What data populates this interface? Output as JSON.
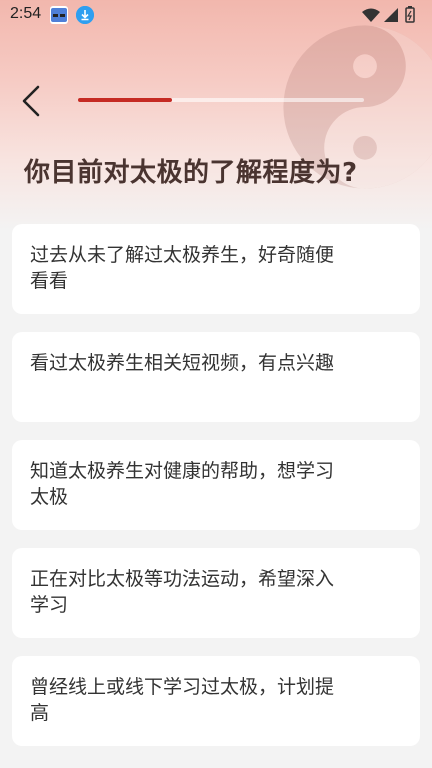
{
  "status_bar": {
    "time": "2:54"
  },
  "progress": {
    "fraction": 0.33
  },
  "question": "你目前对太极的了解程度为?",
  "options": [
    {
      "label": "过去从未了解过太极养生，好奇随便看看"
    },
    {
      "label": "看过太极养生相关短视频，有点兴趣"
    },
    {
      "label": "知道太极养生对健康的帮助，想学习太极"
    },
    {
      "label": "正在对比太极等功法运动，希望深入学习"
    },
    {
      "label": "曾经线上或线下学习过太极，计划提高"
    }
  ],
  "colors": {
    "accent": "#c52a23",
    "background": "#f3f3f3",
    "card": "#ffffff",
    "title": "#4a3430"
  }
}
